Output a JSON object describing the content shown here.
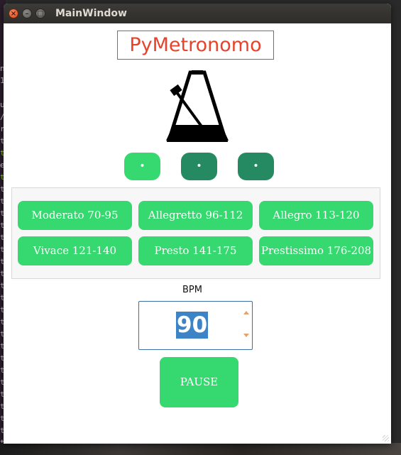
{
  "window": {
    "title": "MainWindow",
    "controls": {
      "close": "×",
      "minimize": "–",
      "maximize": "□"
    }
  },
  "app": {
    "title": "PyMetronomo",
    "logo_icon": "metronome-icon"
  },
  "beats": [
    {
      "label": "•",
      "state": "active",
      "color": "#36d96f"
    },
    {
      "label": "•",
      "state": "inactive",
      "color": "#258a62"
    },
    {
      "label": "•",
      "state": "inactive",
      "color": "#258a62"
    }
  ],
  "presets": [
    {
      "label": "Moderato 70-95"
    },
    {
      "label": "Allegretto 96-112"
    },
    {
      "label": "Allegro 113-120"
    },
    {
      "label": "Vivace 121-140"
    },
    {
      "label": "Presto 141-175"
    },
    {
      "label": "Prestissimo 176-208"
    }
  ],
  "bpm": {
    "label": "BPM",
    "value": "90"
  },
  "pause_button": {
    "label": "PAUSE"
  },
  "colors": {
    "accent_green": "#36d96f",
    "dark_green": "#258a62",
    "title_red": "#e8432a",
    "selection_blue": "#3d84c6"
  }
}
